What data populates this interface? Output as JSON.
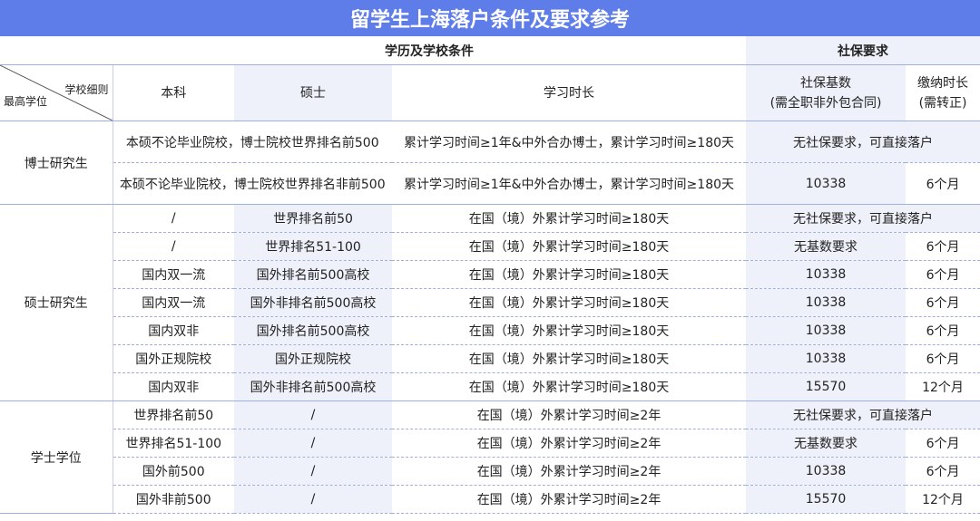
{
  "title": "留学生上海落户条件及要求参考",
  "group_headers": {
    "education": "学历及学校条件",
    "social": "社保要求"
  },
  "diagonal": {
    "top_right": "学校细则",
    "bottom_left": "最高学位"
  },
  "column_headers": {
    "bachelor": "本科",
    "master": "硕士",
    "study": "学习时长",
    "base_line1": "社保基数",
    "base_line2": "(需全职非外包合同)",
    "duration_line1": "缴纳时长",
    "duration_line2": "(需转正)"
  },
  "sections": [
    {
      "level": "博士研究生",
      "rows": [
        {
          "school": "本硕不论毕业院校，博士院校世界排名前500",
          "study": "累计学习时间≥1年&中外合办博士，累计学习时间≥180天",
          "social": "无社保要求，可直接落户"
        },
        {
          "school": "本硕不论毕业院校，博士院校世界排名非前500",
          "study": "累计学习时间≥1年&中外合办博士，累计学习时间≥180天",
          "base": "10338",
          "duration": "6个月"
        }
      ]
    },
    {
      "level": "硕士研究生",
      "rows": [
        {
          "bachelor": "/",
          "master": "世界排名前50",
          "study": "在国（境）外累计学习时间≥180天",
          "social": "无社保要求，可直接落户"
        },
        {
          "bachelor": "/",
          "master": "世界排名51-100",
          "study": "在国（境）外累计学习时间≥180天",
          "base": "无基数要求",
          "duration": "6个月"
        },
        {
          "bachelor": "国内双一流",
          "master": "国外排名前500高校",
          "study": "在国（境）外累计学习时间≥180天",
          "base": "10338",
          "duration": "6个月"
        },
        {
          "bachelor": "国内双一流",
          "master": "国外非排名前500高校",
          "study": "在国（境）外累计学习时间≥180天",
          "base": "10338",
          "duration": "6个月"
        },
        {
          "bachelor": "国内双非",
          "master": "国外排名前500高校",
          "study": "在国（境）外累计学习时间≥180天",
          "base": "10338",
          "duration": "6个月"
        },
        {
          "bachelor": "国外正规院校",
          "master": "国外正规院校",
          "study": "在国（境）外累计学习时间≥180天",
          "base": "10338",
          "duration": "6个月"
        },
        {
          "bachelor": "国内双非",
          "master": "国外非排名前500高校",
          "study": "在国（境）外累计学习时间≥180天",
          "base": "15570",
          "duration": "12个月"
        }
      ]
    },
    {
      "level": "学士学位",
      "rows": [
        {
          "bachelor": "世界排名前50",
          "master": "/",
          "study": "在国（境）外累计学习时间≥2年",
          "social": "无社保要求，可直接落户"
        },
        {
          "bachelor": "世界排名51-100",
          "master": "/",
          "study": "在国（境）外累计学习时间≥2年",
          "base": "无基数要求",
          "duration": "6个月"
        },
        {
          "bachelor": "国外前500",
          "master": "/",
          "study": "在国（境）外累计学习时间≥2年",
          "base": "10338",
          "duration": "6个月"
        },
        {
          "bachelor": "国外非前500",
          "master": "/",
          "study": "在国（境）外累计学习时间≥2年",
          "base": "15570",
          "duration": "12个月"
        }
      ]
    }
  ]
}
